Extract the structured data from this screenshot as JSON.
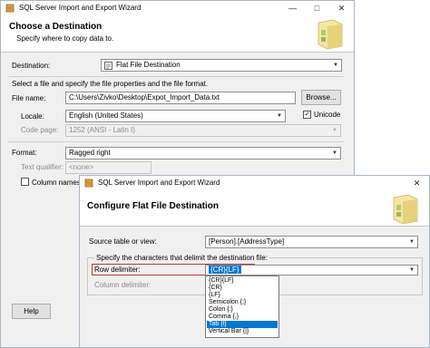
{
  "back_window": {
    "title": "SQL Server Import and Export Wizard",
    "header_title": "Choose a Destination",
    "header_subtitle": "Specify where to copy data to.",
    "destination_label": "Destination:",
    "destination_value": "Flat File Destination",
    "instructions": "Select a file and specify the file properties and the file format.",
    "file_name_label": "File name:",
    "file_name_value": "C:\\Users\\Zivko\\Desktop\\Expot_Import_Data.txt",
    "browse_label": "Browse...",
    "locale_label": "Locale:",
    "locale_value": "English (United States)",
    "unicode_label": "Unicode",
    "code_page_label": "Code page:",
    "code_page_value": "1252  (ANSI - Latin I)",
    "format_label": "Format:",
    "format_value": "Ragged right",
    "text_qualifier_label": "Text qualifier:",
    "text_qualifier_value": "<none>",
    "column_names_label": "Column names in",
    "help_label": "Help"
  },
  "front_window": {
    "title": "SQL Server Import and Export Wizard",
    "header_title": "Configure Flat File Destination",
    "source_label": "Source table or view:",
    "source_value": "[Person].[AddressType]",
    "group_label": "Specify the characters that delimit the destination file:",
    "row_delimiter_label": "Row delimiter:",
    "row_delimiter_value": "{CR}{LF}",
    "column_delimiter_label": "Column delimiter:",
    "delimiter_options": [
      "{CR}{LF}",
      "{CR}",
      "{LF}",
      "Semicolon {;}",
      "Colon {:}",
      "Comma {,}",
      "Tab {t}",
      "Vertical Bar {|}"
    ],
    "selected_option": "Tab {t}"
  },
  "colors": {
    "highlight_border": "#c0392b",
    "selection": "#0078d7"
  }
}
